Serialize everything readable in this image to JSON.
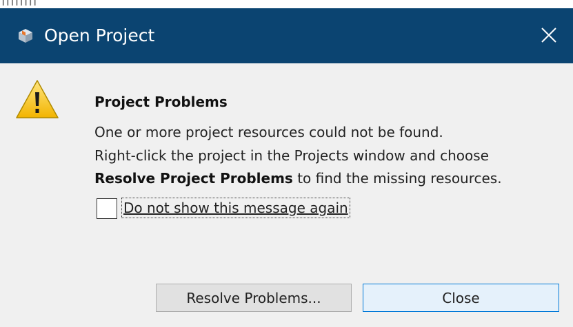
{
  "window": {
    "title": "Open Project",
    "title_icon": "project-cube-icon",
    "close_icon": "close-icon",
    "titlebar_color": "#0b4471"
  },
  "message": {
    "icon": "warning-icon",
    "title": "Project Problems",
    "line1": "One or more project resources could not be found.",
    "line2": "Right-click the project in the Projects window and choose",
    "line3_bold": "Resolve Project Problems",
    "line3_rest": " to find the missing resources."
  },
  "checkbox": {
    "label": "Do not show this message again",
    "checked": false
  },
  "buttons": {
    "resolve_label": "Resolve Problems...",
    "close_label": "Close",
    "close_border_color": "#0078d7"
  }
}
